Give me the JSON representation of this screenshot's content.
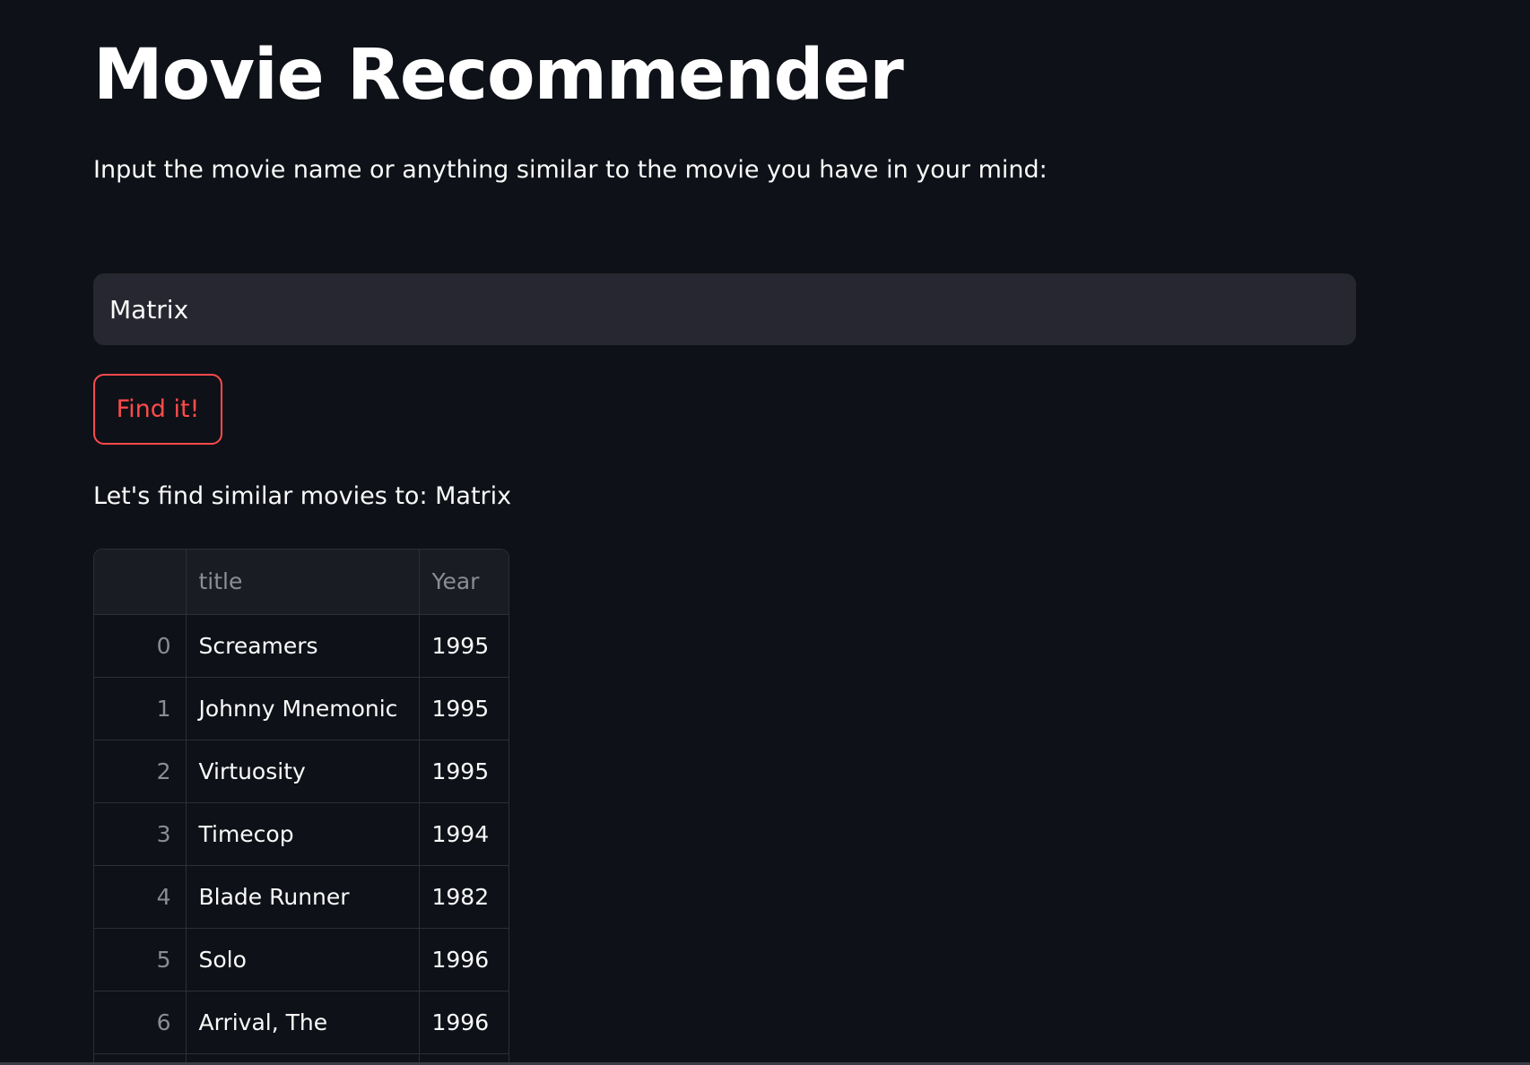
{
  "app": {
    "title": "Movie Recommender",
    "prompt": "Input the movie name or anything similar to the movie you have in your mind:"
  },
  "search": {
    "value": "Matrix"
  },
  "actions": {
    "find_label": "Find it!"
  },
  "result": {
    "heading": "Let's find similar movies to: Matrix"
  },
  "table": {
    "columns": [
      "",
      "title",
      "Year"
    ],
    "rows": [
      {
        "index": "0",
        "title": "Screamers",
        "year": "1995"
      },
      {
        "index": "1",
        "title": "Johnny Mnemonic",
        "year": "1995"
      },
      {
        "index": "2",
        "title": "Virtuosity",
        "year": "1995"
      },
      {
        "index": "3",
        "title": "Timecop",
        "year": "1994"
      },
      {
        "index": "4",
        "title": "Blade Runner",
        "year": "1982"
      },
      {
        "index": "5",
        "title": "Solo",
        "year": "1996"
      },
      {
        "index": "6",
        "title": "Arrival, The",
        "year": "1996"
      }
    ]
  },
  "colors": {
    "background": "#0e1117",
    "input_background": "#262730",
    "accent": "#ff4b4b",
    "text": "#fafafa",
    "muted_text": "#8b8d94"
  }
}
